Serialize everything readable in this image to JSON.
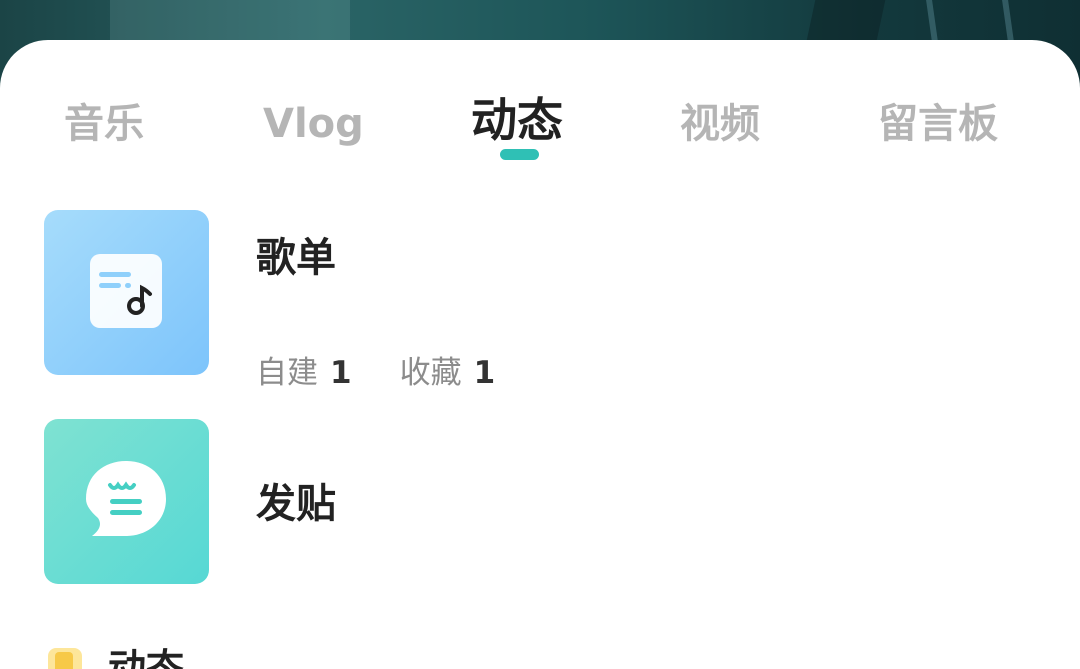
{
  "tabs": [
    {
      "label": "音乐"
    },
    {
      "label": "Vlog"
    },
    {
      "label": "动态",
      "active": true
    },
    {
      "label": "视频"
    },
    {
      "label": "留言板"
    }
  ],
  "accent_color": "#2fc0b5",
  "cards": {
    "playlist": {
      "title": "歌单",
      "icon": "music-note-icon",
      "stats": {
        "created_label": "自建",
        "created_value": "1",
        "favorited_label": "收藏",
        "favorited_value": "1"
      }
    },
    "post": {
      "title": "发贴",
      "icon": "speech-bubble-icon"
    }
  },
  "section": {
    "title": "动态",
    "icon": "note-icon"
  }
}
